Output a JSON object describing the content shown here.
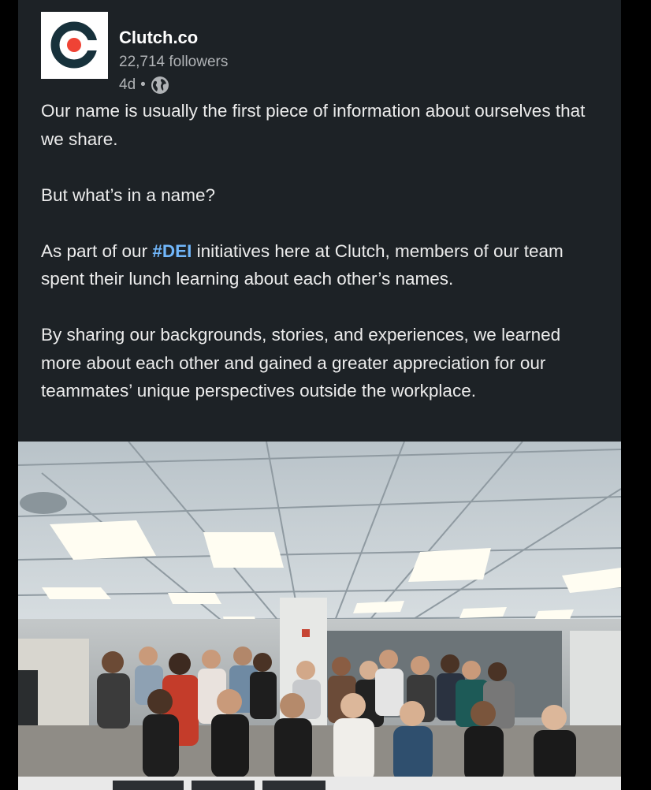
{
  "post": {
    "author": "Clutch.co",
    "followers": "22,714 followers",
    "time": "4d",
    "separator": "•",
    "visibility_icon": "globe-icon",
    "logo_icon": "clutch-logo-icon",
    "paragraphs": [
      {
        "text": "Our name is usually the first piece of information about ourselves that we share."
      },
      {
        "text": "But what’s in a name?"
      },
      {
        "before": "As part of our ",
        "hashtag": "#DEI",
        "after": " initiatives here at Clutch, members of our team spent their lunch learning about each other’s names."
      },
      {
        "text": "By sharing our backgrounds, stories, and experiences, we learned more about each other and gained a greater appreciation for our teammates’ unique perspectives outside the workplace."
      }
    ]
  },
  "colors": {
    "card_background": "#1d2226",
    "hashtag": "#71b7fb",
    "logo_red": "#ef4335",
    "logo_dark": "#17313b"
  }
}
